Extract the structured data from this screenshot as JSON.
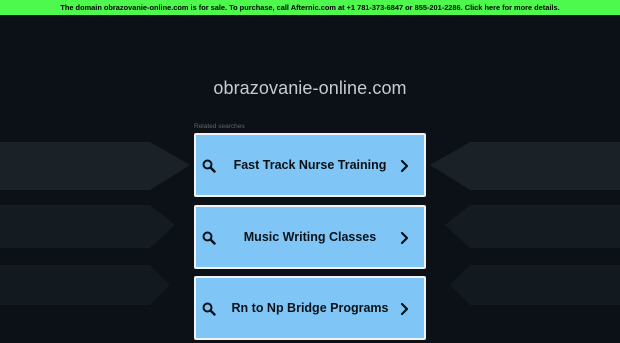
{
  "banner": {
    "text": "The domain obrazovanie-online.com is for sale. To purchase, call Afternic.com at +1 781-373-6847 or 855-201-2286. Click here for more details."
  },
  "domain": {
    "title": "obrazovanie-online.com"
  },
  "related": {
    "heading": "Related searches",
    "items": [
      {
        "label": "Fast Track Nurse Training"
      },
      {
        "label": "Music Writing Classes"
      },
      {
        "label": "Rn to Np Bridge Programs"
      }
    ]
  },
  "colors": {
    "banner": "#4cf94c",
    "background": "#0b1117",
    "card": "#7fc6f6",
    "card_border": "#f2f4f6"
  },
  "icons": {
    "search": "magnifier-icon",
    "arrow": "chevron-right-icon"
  }
}
